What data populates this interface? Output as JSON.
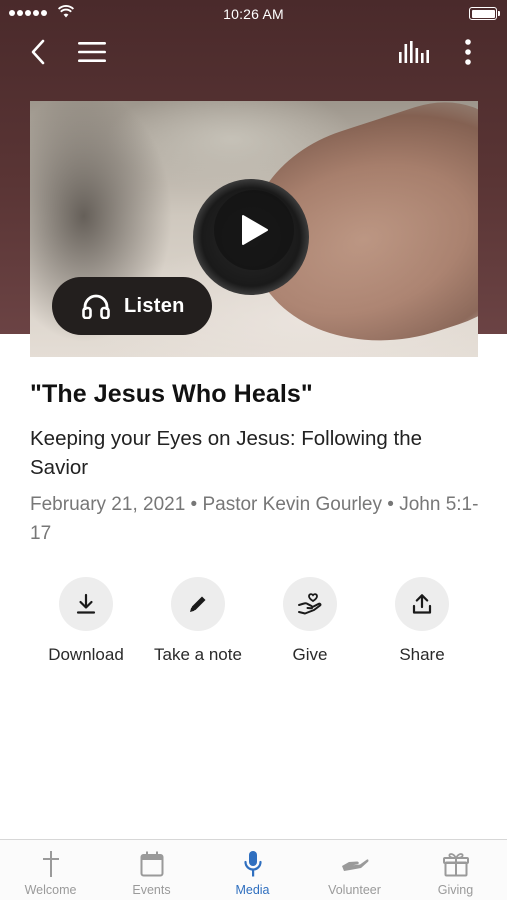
{
  "status_bar": {
    "time": "10:26 AM"
  },
  "video": {
    "listen_label": "Listen"
  },
  "sermon": {
    "title": "\"The Jesus Who Heals\"",
    "series": "Keeping your Eyes on Jesus: Following the Savior",
    "meta": "February 21, 2021 • Pastor Kevin Gourley • John 5:1-17"
  },
  "actions": [
    {
      "label": "Download",
      "icon": "download-icon"
    },
    {
      "label": "Take a note",
      "icon": "pencil-icon"
    },
    {
      "label": "Give",
      "icon": "give-hand-heart-icon"
    },
    {
      "label": "Share",
      "icon": "share-icon"
    }
  ],
  "tabs": [
    {
      "label": "Welcome",
      "icon": "cross-icon",
      "active": false
    },
    {
      "label": "Events",
      "icon": "calendar-icon",
      "active": false
    },
    {
      "label": "Media",
      "icon": "microphone-icon",
      "active": true
    },
    {
      "label": "Volunteer",
      "icon": "helping-hand-icon",
      "active": false
    },
    {
      "label": "Giving",
      "icon": "gift-icon",
      "active": false
    }
  ],
  "colors": {
    "hero_background": "#5a3535",
    "active_tab": "#2f6fbf",
    "inactive_tab": "#9a9a9a",
    "listen_button": "#231f1e"
  }
}
